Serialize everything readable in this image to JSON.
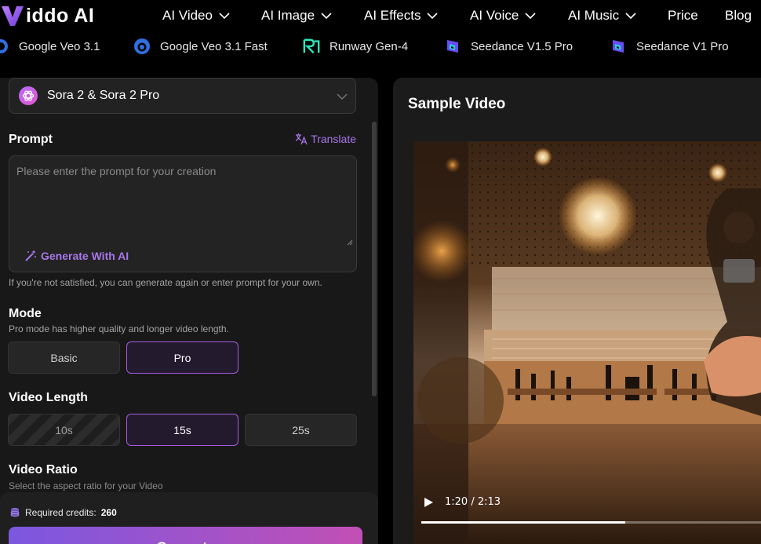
{
  "brand": {
    "name": "iddo AI",
    "accent": "#a876e8"
  },
  "nav": [
    {
      "label": "AI Video",
      "has_dropdown": true
    },
    {
      "label": "AI Image",
      "has_dropdown": true
    },
    {
      "label": "AI Effects",
      "has_dropdown": true
    },
    {
      "label": "AI Voice",
      "has_dropdown": true
    },
    {
      "label": "AI Music",
      "has_dropdown": true
    },
    {
      "label": "Price",
      "has_dropdown": false
    },
    {
      "label": "Blog",
      "has_dropdown": false
    }
  ],
  "models": [
    {
      "label": "Google Veo 3.1",
      "icon": "google-veo-icon"
    },
    {
      "label": "Google Veo 3.1 Fast",
      "icon": "google-veo-icon"
    },
    {
      "label": "Runway Gen-4",
      "icon": "runway-icon"
    },
    {
      "label": "Seedance V1.5 Pro",
      "icon": "seedance-icon"
    },
    {
      "label": "Seedance V1 Pro",
      "icon": "seedance-icon"
    }
  ],
  "model_select": {
    "value": "Sora 2 & Sora 2 Pro",
    "icon": "openai-icon"
  },
  "prompt": {
    "title": "Prompt",
    "translate_label": "Translate",
    "placeholder": "Please enter the prompt for your creation",
    "value": "",
    "generate_ai_label": "Generate With AI",
    "hint": "If you're not satisfied, you can generate again or enter prompt for your own."
  },
  "mode": {
    "title": "Mode",
    "description": "Pro mode has higher quality and longer video length.",
    "options": [
      "Basic",
      "Pro"
    ],
    "selected": "Pro"
  },
  "video_length": {
    "title": "Video Length",
    "options": [
      "10s",
      "15s",
      "25s"
    ],
    "selected": "15s",
    "disabled": [
      "10s"
    ]
  },
  "video_ratio": {
    "title": "Video Ratio",
    "description": "Select the aspect ratio for your Video"
  },
  "footer": {
    "credits_label": "Required credits:",
    "credits_value": "260",
    "generate_label": "Generate"
  },
  "sample": {
    "title": "Sample Video",
    "time": "1:20 / 2:13",
    "progress": 0.6
  }
}
